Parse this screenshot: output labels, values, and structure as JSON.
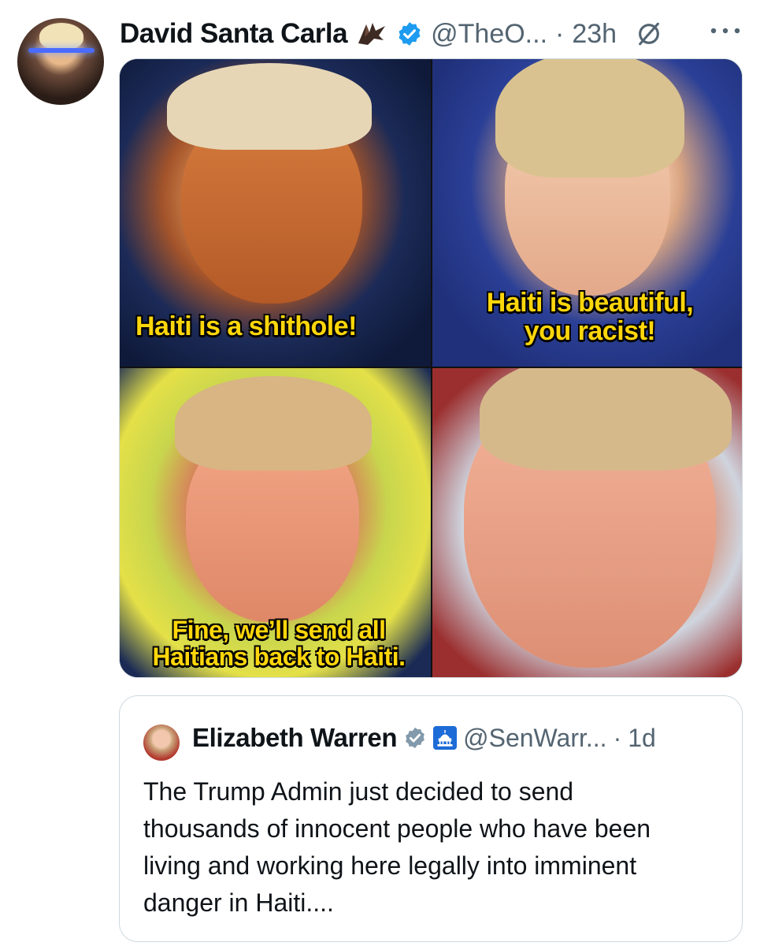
{
  "post": {
    "display_name": "David Santa Carla",
    "handle": "@TheO...",
    "separator": "·",
    "time": "23h",
    "icons": {
      "name_emoji": "bat-icon",
      "verified": "verified-icon",
      "grok": "grok-icon",
      "more": "more-options-icon"
    },
    "colors": {
      "verified_blue": "#1d9bf0",
      "meme_yellow": "#ffd60a"
    }
  },
  "meme": {
    "captions": {
      "top_left": "Haiti is a shithole!",
      "top_right_line1": "Haiti is beautiful,",
      "top_right_line2": "you racist!",
      "bottom_left_line1": "Fine, we’ll send all",
      "bottom_left_line2": "Haitians back to Haiti."
    }
  },
  "quoted": {
    "display_name": "Elizabeth Warren",
    "handle": "@SenWarr...",
    "separator": "·",
    "time": "1d",
    "text": "The Trump Admin just decided to send thousands of innocent people who have been living and working here legally into imminent danger in Haiti...."
  }
}
